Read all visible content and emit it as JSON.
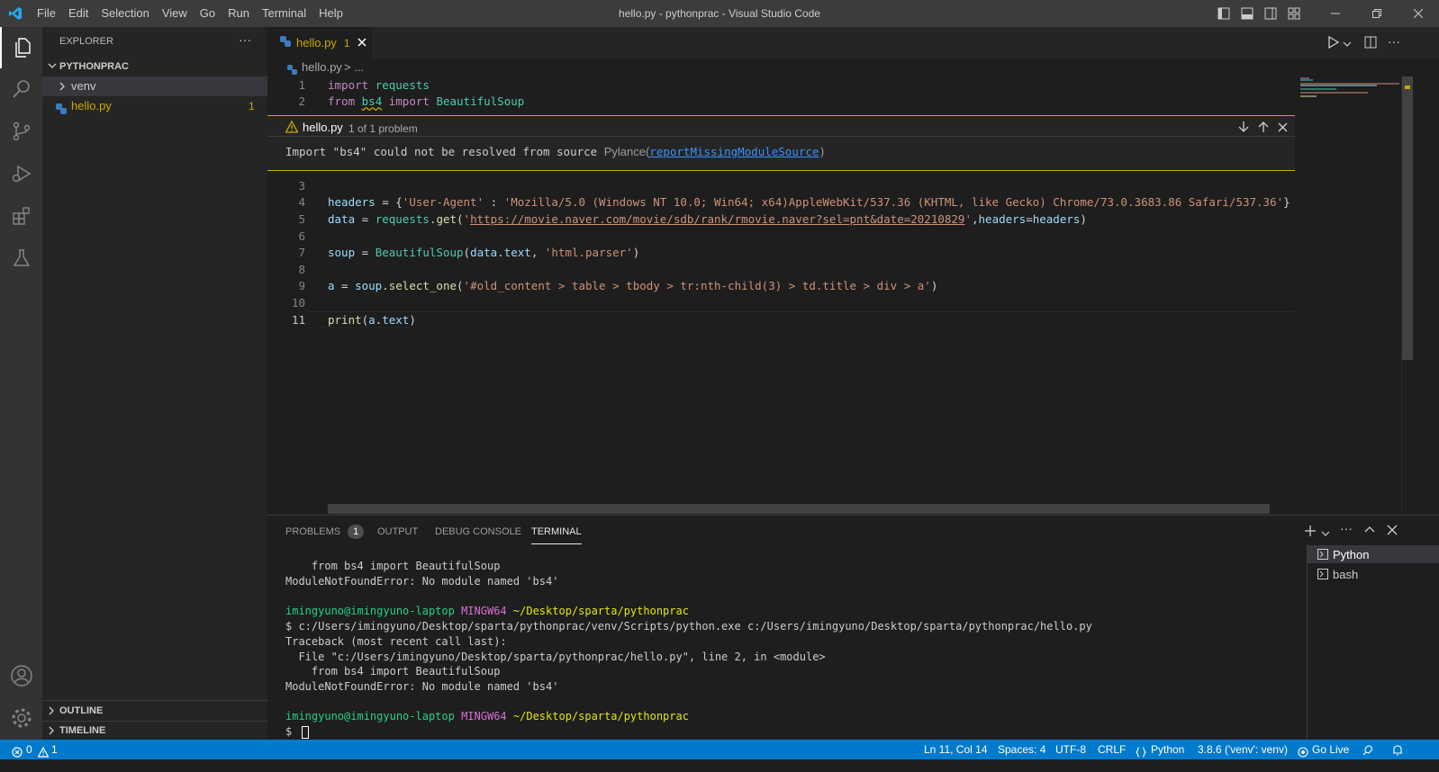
{
  "window": {
    "title": "hello.py - pythonprac - Visual Studio Code",
    "menu": [
      "File",
      "Edit",
      "Selection",
      "View",
      "Go",
      "Run",
      "Terminal",
      "Help"
    ]
  },
  "sidebar": {
    "header": "EXPLORER",
    "more": "···",
    "folder": "PYTHONPRAC",
    "items": [
      {
        "label": "venv",
        "type": "folder"
      },
      {
        "label": "hello.py",
        "type": "file",
        "badge": "1"
      }
    ],
    "outline": "OUTLINE",
    "timeline": "TIMELINE"
  },
  "tab": {
    "label": "hello.py",
    "badge": "1"
  },
  "breadcrumb": {
    "file": "hello.py",
    "sep": "> ..."
  },
  "editor": {
    "line_numbers": [
      "1",
      "2",
      "3",
      "4",
      "5",
      "6",
      "7",
      "8",
      "9",
      "10",
      "11"
    ],
    "current_line": "11"
  },
  "peek": {
    "file": "hello.py",
    "count": "1 of 1 problem",
    "message": "Import \"bs4\" could not be resolved from source",
    "source": "Pylance(",
    "code": "reportMissingModuleSource",
    "close_paren": ")"
  },
  "panel": {
    "tabs": [
      "PROBLEMS",
      "OUTPUT",
      "DEBUG CONSOLE",
      "TERMINAL"
    ],
    "problems_count": "1",
    "active_tab": "TERMINAL",
    "terminals": [
      "Python",
      "bash"
    ],
    "terminal_lines": [
      {
        "text": "    from bs4 import BeautifulSoup"
      },
      {
        "text": "ModuleNotFoundError: No module named 'bs4'"
      },
      {
        "text": ""
      },
      {
        "user": "imingyuno@imingyuno-laptop",
        "host": "MINGW64",
        "path": "~/Desktop/sparta/pythonprac"
      },
      {
        "text": "$ c:/Users/imingyuno/Desktop/sparta/pythonprac/venv/Scripts/python.exe c:/Users/imingyuno/Desktop/sparta/pythonprac/hello.py"
      },
      {
        "text": "Traceback (most recent call last):"
      },
      {
        "text": "  File \"c:/Users/imingyuno/Desktop/sparta/pythonprac/hello.py\", line 2, in <module>"
      },
      {
        "text": "    from bs4 import BeautifulSoup"
      },
      {
        "text": "ModuleNotFoundError: No module named 'bs4'"
      },
      {
        "text": ""
      },
      {
        "user": "imingyuno@imingyuno-laptop",
        "host": "MINGW64",
        "path": "~/Desktop/sparta/pythonprac"
      },
      {
        "text": "$ "
      }
    ]
  },
  "status": {
    "errors": "0",
    "warnings": "1",
    "position": "Ln 11, Col 14",
    "spaces": "Spaces: 4",
    "encoding": "UTF-8",
    "eol": "CRLF",
    "language": "Python",
    "interpreter": "3.8.6 ('venv': venv)",
    "golive": "Go Live"
  },
  "colors": {
    "accent": "#007acc",
    "warning": "#cca700",
    "activity_bar": "#333333",
    "sidebar": "#252526",
    "editor": "#1e1e1e"
  }
}
